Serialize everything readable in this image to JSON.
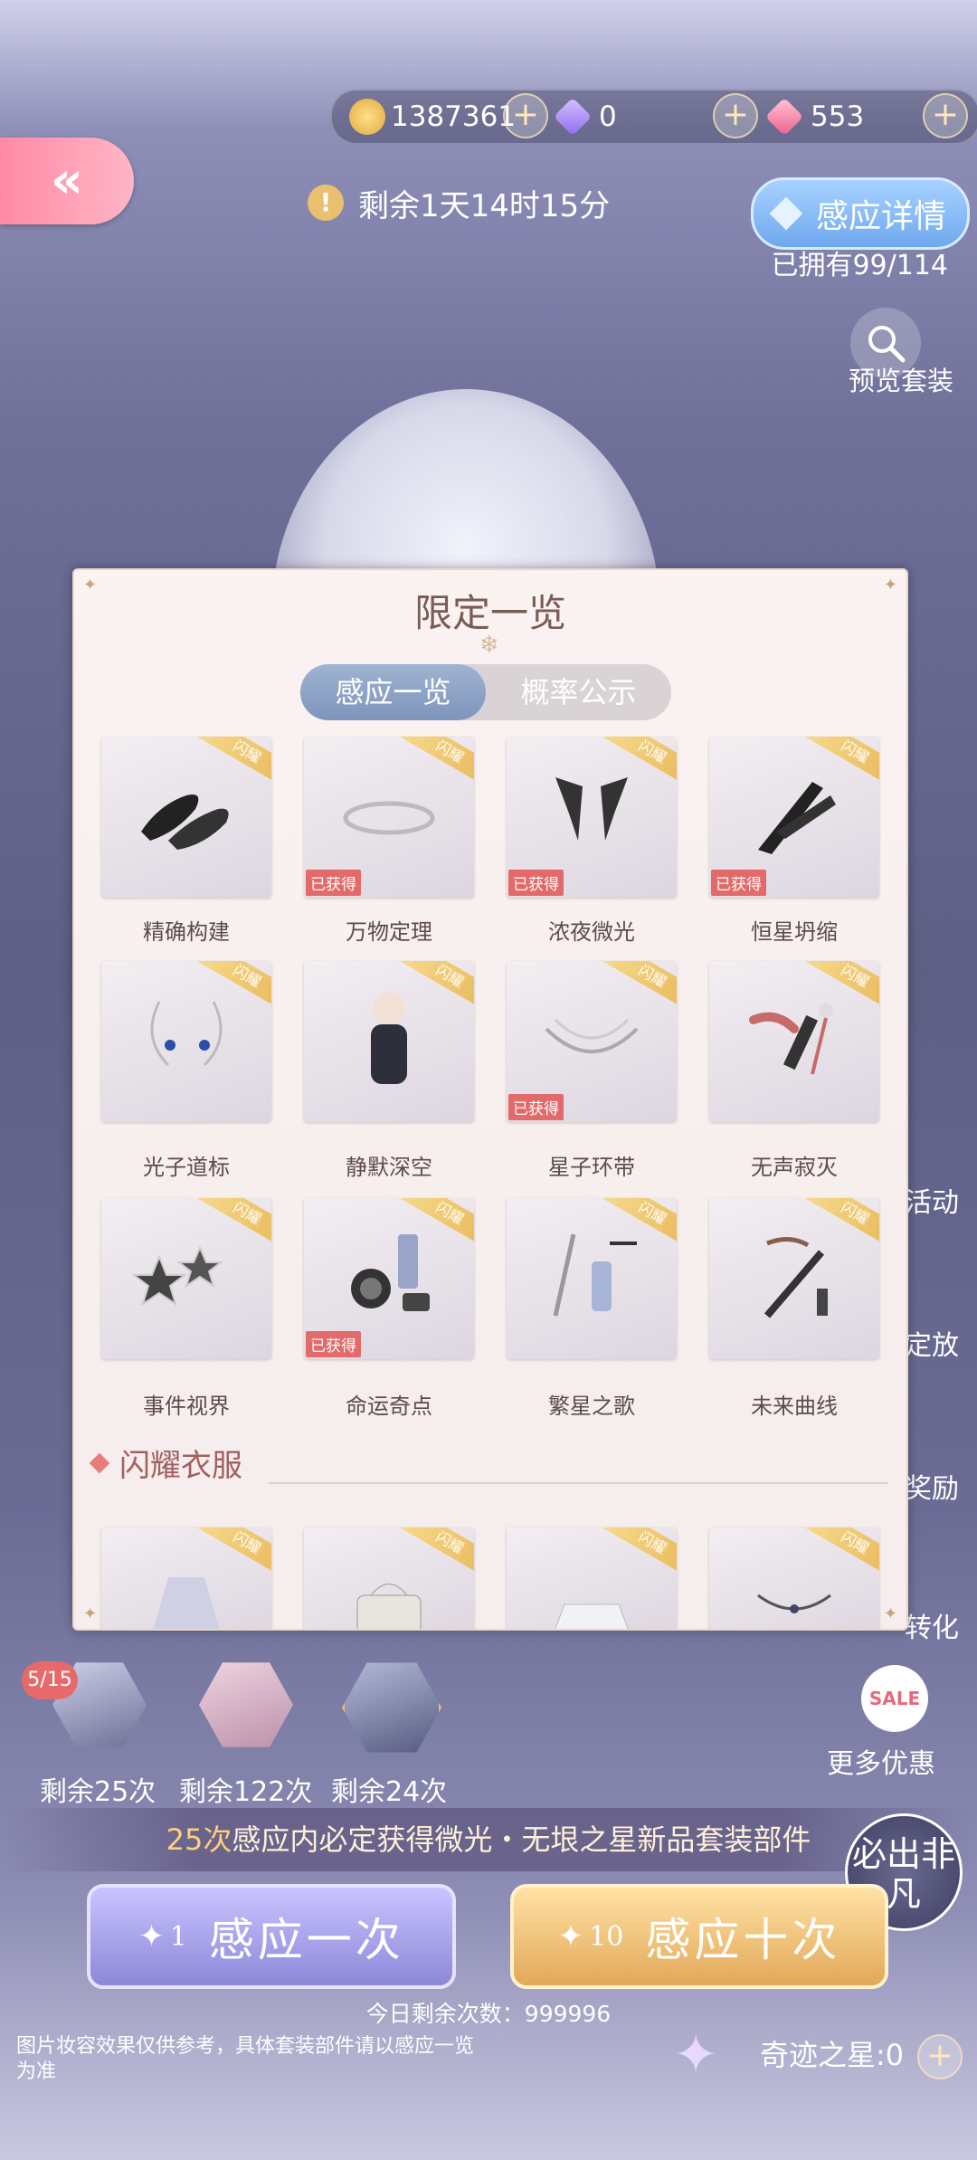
{
  "currencies": [
    {
      "icon": "coin-icon",
      "value": "1387361"
    },
    {
      "icon": "purple-diamond-icon",
      "value": "0"
    },
    {
      "icon": "pink-diamond-icon",
      "value": "553"
    }
  ],
  "header": {
    "back_label": "«",
    "timer": "剩余1天14时15分",
    "detail_button": "感应详情",
    "owned": "已拥有99/114",
    "preview_label": "预览套装"
  },
  "side_labels": [
    "活动",
    "定放",
    "奖励",
    "转化"
  ],
  "modal": {
    "title": "限定一览",
    "tabs": [
      {
        "label": "感应一览",
        "active": true
      },
      {
        "label": "概率公示",
        "active": false
      }
    ],
    "ribbon_text": "闪耀",
    "owned_tag": "已获得",
    "items": [
      {
        "name": "精确构建",
        "owned": false,
        "icon": "shoes-icon"
      },
      {
        "name": "万物定理",
        "owned": true,
        "icon": "tiara-icon"
      },
      {
        "name": "浓夜微光",
        "owned": true,
        "icon": "wings-icon"
      },
      {
        "name": "恒星坍缩",
        "owned": true,
        "icon": "gloves-icon"
      },
      {
        "name": "光子道标",
        "owned": false,
        "icon": "earrings-icon"
      },
      {
        "name": "静默深空",
        "owned": false,
        "icon": "bodysuit-icon"
      },
      {
        "name": "星子环带",
        "owned": true,
        "icon": "necklace-icon"
      },
      {
        "name": "无声寂灭",
        "owned": false,
        "icon": "lipstick-icon"
      },
      {
        "name": "事件视界",
        "owned": false,
        "icon": "hairclip-icon"
      },
      {
        "name": "命运奇点",
        "owned": true,
        "icon": "makeup-icon"
      },
      {
        "name": "繁星之歌",
        "owned": false,
        "icon": "wand-icon"
      },
      {
        "name": "未来曲线",
        "owned": false,
        "icon": "brush-icon"
      }
    ],
    "section_title": "闪耀衣服",
    "section_items": [
      {
        "icon": "dress-icon"
      },
      {
        "icon": "handbag-icon"
      },
      {
        "icon": "skirt-icon"
      },
      {
        "icon": "hairpin-icon"
      }
    ]
  },
  "pity": {
    "badge": "5/15",
    "remains": [
      "剩余25次",
      "剩余122次",
      "剩余24次"
    ]
  },
  "guarantee": {
    "count": "25次",
    "text": "感应内必定获得微光・无垠之星新品套装部件"
  },
  "buttons": {
    "single": {
      "count": "1",
      "label": "感应一次"
    },
    "ten": {
      "count": "10",
      "label": "感应十次"
    }
  },
  "today_remaining": "今日剩余次数：999996",
  "disclaimer": "图片妆容效果仅供参考，具体套装部件请以感应一览为准",
  "miracle_star": "奇迹之星:0",
  "more_deals": {
    "icon_text": "SALE",
    "label": "更多优惠"
  },
  "feifan_badge": "必出非凡"
}
